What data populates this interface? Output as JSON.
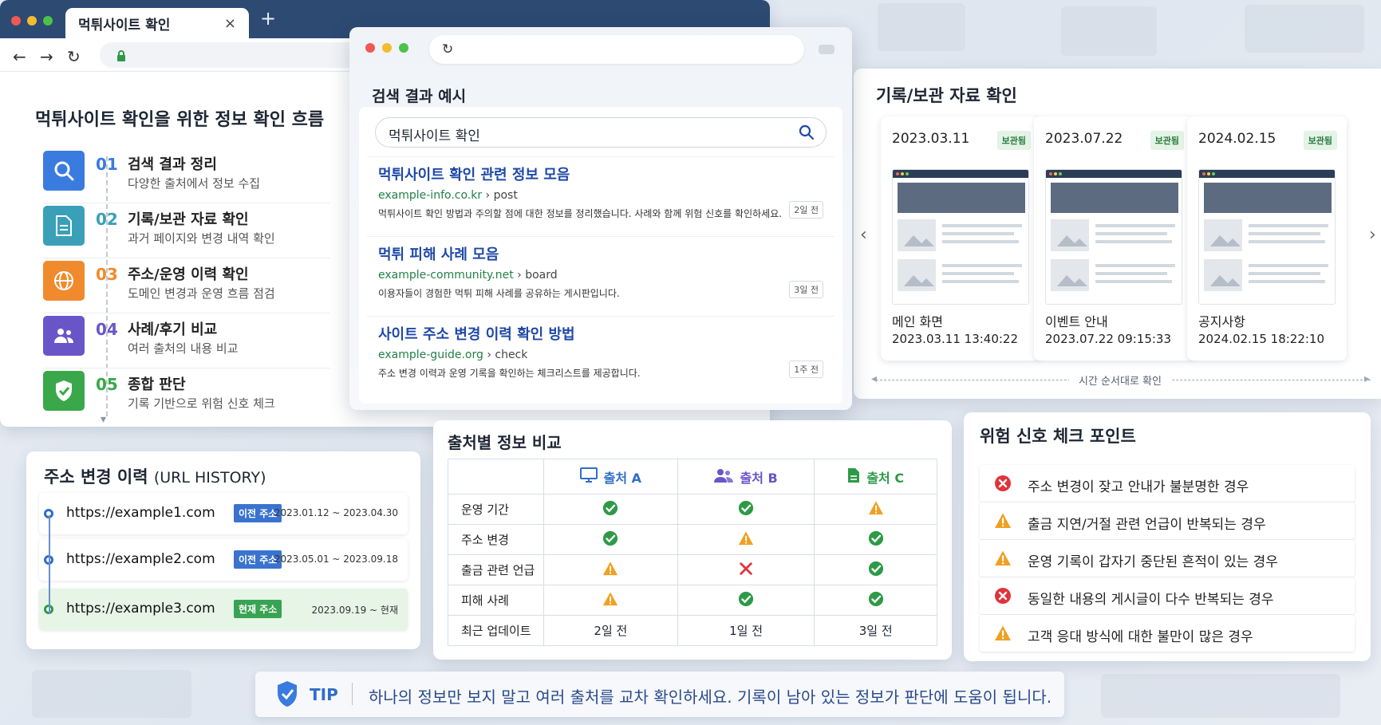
{
  "browser_left": {
    "tab_title": "먹튀사이트 확인",
    "tab_close": "×",
    "new_tab": "+"
  },
  "flow": {
    "title": "먹튀사이트 확인을 위한 정보 확인 흐름",
    "steps": [
      {
        "num": "01",
        "title": "검색 결과 정리",
        "desc": "다양한 출처에서 정보 수집",
        "color": "#3a7be0",
        "icon": "search-icon"
      },
      {
        "num": "02",
        "title": "기록/보관 자료 확인",
        "desc": "과거 페이지와 변경 내역 확인",
        "color": "#3aa0b8",
        "icon": "document-icon"
      },
      {
        "num": "03",
        "title": "주소/운영 이력 확인",
        "desc": "도메인 변경과 운영 흐름 점검",
        "color": "#f08a2c",
        "icon": "globe-icon"
      },
      {
        "num": "04",
        "title": "사례/후기 비교",
        "desc": "여러 출처의 내용 비교",
        "color": "#6a55c8",
        "icon": "users-icon"
      },
      {
        "num": "05",
        "title": "종합 판단",
        "desc": "기록 기반으로 위험 신호 체크",
        "color": "#3aa84a",
        "icon": "shield-check-icon"
      }
    ]
  },
  "search": {
    "heading": "검색 결과 예시",
    "query": "먹튀사이트 확인",
    "results": [
      {
        "title": "먹튀사이트 확인 관련 정보 모음",
        "domain": "example-info.co.kr",
        "path": " › post",
        "desc": "먹튀사이트 확인 방법과 주의할 점에 대한 정보를 정리했습니다. 사례와 함께 위험 신호를 확인하세요.",
        "age": "2일 전"
      },
      {
        "title": "먹튀 피해 사례 모음",
        "domain": "example-community.net",
        "path": " › board",
        "desc": "이용자들이 경험한 먹튀 피해 사례를 공유하는 게시판입니다.",
        "age": "3일 전"
      },
      {
        "title": "사이트 주소 변경 이력 확인 방법",
        "domain": "example-guide.org",
        "path": " › check",
        "desc": "주소 변경 이력과 운영 기록을 확인하는 체크리스트를 제공합니다.",
        "age": "1주 전"
      }
    ]
  },
  "archive": {
    "title": "기록/보관 자료 확인",
    "caption": "시간 순서대로 확인",
    "snapshots": [
      {
        "date": "2023.03.11",
        "badge": "보관됨",
        "name": "메인 화면",
        "time": "2023.03.11 13:40:22"
      },
      {
        "date": "2023.07.22",
        "badge": "보관됨",
        "name": "이벤트 안내",
        "time": "2023.07.22 09:15:33"
      },
      {
        "date": "2024.02.15",
        "badge": "보관됨",
        "name": "공지사항",
        "time": "2024.02.15 18:22:10"
      }
    ],
    "prev": "‹",
    "next": "›"
  },
  "url_history": {
    "title": "주소 변경 이력",
    "title_en": "(URL HISTORY)",
    "rows": [
      {
        "url": "https://example1.com",
        "badge": "이전 주소",
        "range": "2023.01.12 ~ 2023.04.30"
      },
      {
        "url": "https://example2.com",
        "badge": "이전 주소",
        "range": "2023.05.01 ~ 2023.09.18"
      },
      {
        "url": "https://example3.com",
        "badge": "현재 주소",
        "range": "2023.09.19 ~ 현재"
      }
    ]
  },
  "compare": {
    "title": "출처별 정보 비교",
    "columns": [
      "출처 A",
      "출처 B",
      "출처 C"
    ],
    "rows": [
      {
        "label": "운영 기간",
        "cells": [
          "ok",
          "ok",
          "warn"
        ]
      },
      {
        "label": "주소 변경",
        "cells": [
          "ok",
          "warn",
          "ok"
        ]
      },
      {
        "label": "출금 관련 언급",
        "cells": [
          "warn",
          "bad",
          "ok"
        ]
      },
      {
        "label": "피해 사례",
        "cells": [
          "warn",
          "ok",
          "ok"
        ]
      },
      {
        "label": "최근 업데이트",
        "cells": [
          "2일 전",
          "1일 전",
          "3일 전"
        ]
      }
    ]
  },
  "risk": {
    "title": "위험 신호 체크 포인트",
    "items": [
      {
        "type": "bad",
        "text": "주소 변경이 잦고 안내가 불분명한 경우"
      },
      {
        "type": "warn",
        "text": "출금 지연/거절 관련 언급이 반복되는 경우"
      },
      {
        "type": "warn",
        "text": "운영 기록이 갑자기 중단된 흔적이 있는 경우"
      },
      {
        "type": "bad",
        "text": "동일한 내용의 게시글이 다수 반복되는 경우"
      },
      {
        "type": "warn",
        "text": "고객 응대 방식에 대한 불만이 많은 경우"
      }
    ]
  },
  "tip": {
    "label": "TIP",
    "text": "하나의 정보만 보지 말고 여러 출처를 교차 확인하세요. 기록이 남아 있는 정보가 판단에 도움이 됩니다."
  },
  "colors": {
    "ok": "#2e9a47",
    "warn": "#f0a020",
    "bad": "#e0333a",
    "link": "#1f49a8",
    "accent": "#2f6ec7"
  }
}
